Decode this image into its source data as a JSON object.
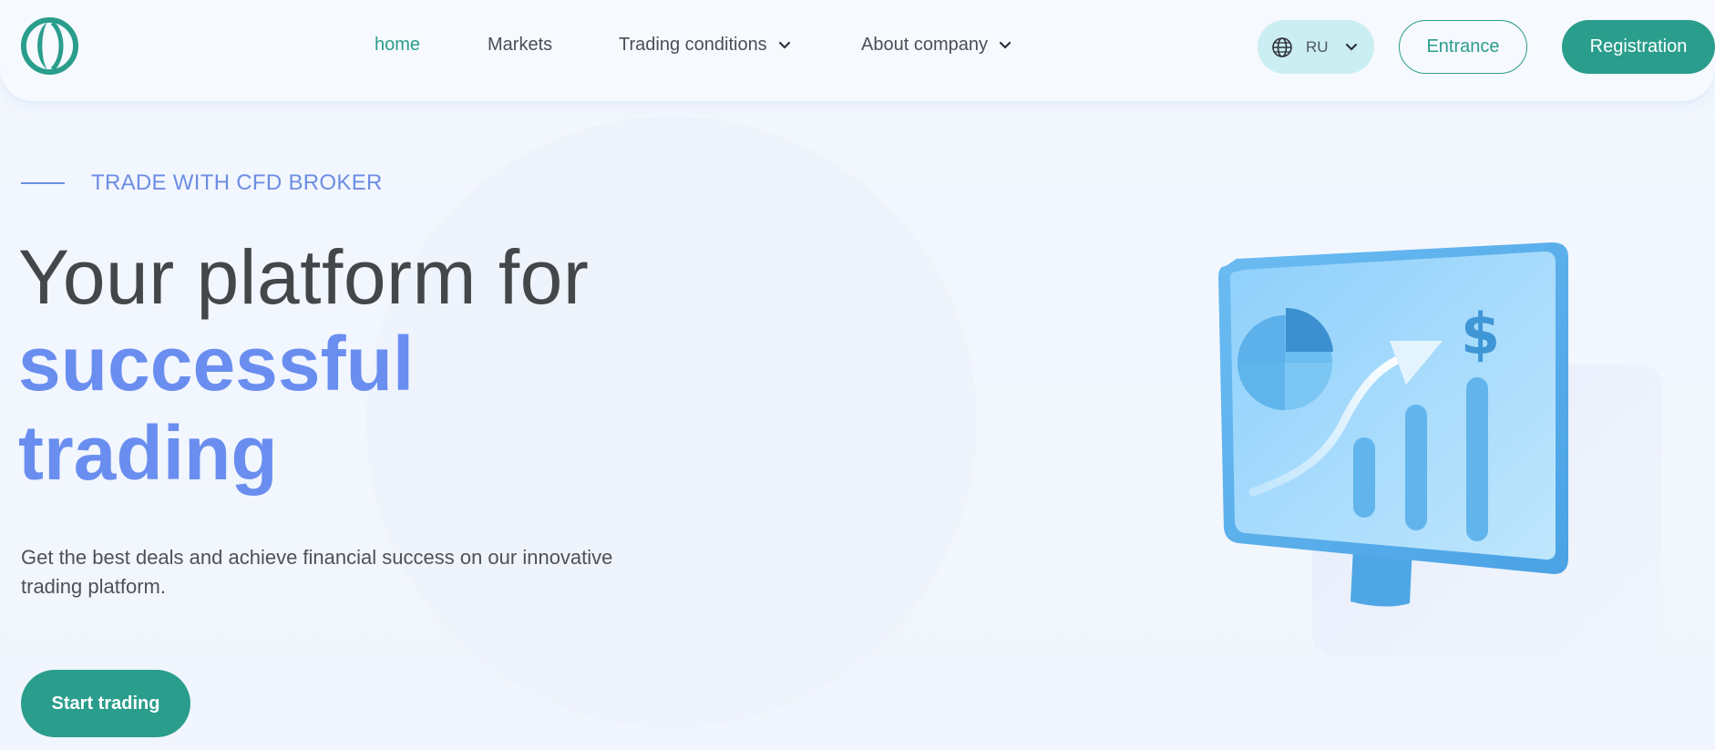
{
  "header": {
    "nav": [
      {
        "label": "home",
        "active": true,
        "dropdown": false
      },
      {
        "label": "Markets",
        "active": false,
        "dropdown": false
      },
      {
        "label": "Trading conditions",
        "active": false,
        "dropdown": true
      },
      {
        "label": "About company",
        "active": false,
        "dropdown": true
      }
    ],
    "language": {
      "code": "RU",
      "icon": "globe-icon"
    },
    "entrance_label": "Entrance",
    "registration_label": "Registration"
  },
  "hero": {
    "eyebrow": "TRADE WITH CFD BROKER",
    "title_line1": "Your platform for",
    "title_accent": "successful trading",
    "description": "Get the best deals and achieve financial success on our innovative trading platform.",
    "cta_label": "Start trading"
  },
  "illustration": {
    "icon": "trading-monitor-icon",
    "currency_symbol": "$"
  },
  "colors": {
    "brand_green": "#2a9d8c",
    "accent_blue": "#6a8ef0",
    "heading": "#444649",
    "lang_bg": "#cbeef3"
  }
}
